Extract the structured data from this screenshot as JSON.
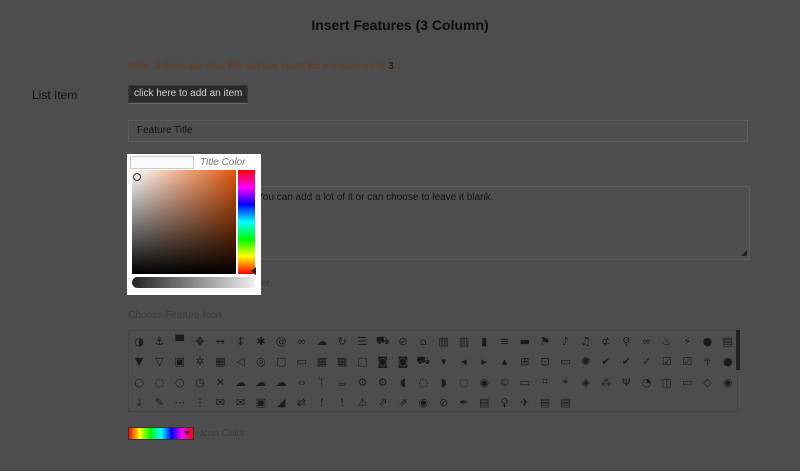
{
  "header": {
    "title": "Insert Features (3 Column)"
  },
  "note": {
    "prefix": "Note: 3 items per row. Per section insert for a maximum of ",
    "max": "3",
    "suffix": "."
  },
  "list_item": {
    "label": "List Item",
    "add_button": "click here to add an item"
  },
  "feature_title": {
    "value": "Feature Title"
  },
  "title_color": {
    "label": "Title Color"
  },
  "description": {
    "visible_text": "You can add a lot of it or can choose to leave it blank."
  },
  "color_picker": {
    "hue_color": "#e0560c"
  },
  "hidden_label_fragment": {
    "text": "er"
  },
  "icon_chooser": {
    "label": "Choose Feature Icon",
    "icons": [
      {
        "n": "adjust-icon",
        "g": "◑"
      },
      {
        "n": "anchor-icon",
        "g": "⚓"
      },
      {
        "n": "archive-icon",
        "g": "▀"
      },
      {
        "n": "move-icon",
        "g": "✥"
      },
      {
        "n": "arrows-h-icon",
        "g": "↔"
      },
      {
        "n": "arrows-v-icon",
        "g": "↕"
      },
      {
        "n": "asterisk-icon",
        "g": "✱"
      },
      {
        "n": "at-icon",
        "g": "@"
      },
      {
        "n": "link-icon",
        "g": "∞"
      },
      {
        "n": "cloud-icon",
        "g": "☁"
      },
      {
        "n": "refresh-icon",
        "g": "↻"
      },
      {
        "n": "list-icon",
        "g": "☰"
      },
      {
        "n": "car-icon",
        "g": "⛟"
      },
      {
        "n": "ban-icon",
        "g": "⊘"
      },
      {
        "n": "bank-icon",
        "g": "⌂"
      },
      {
        "n": "bar-chart-icon",
        "g": "▥"
      },
      {
        "n": "bar-chart-o-icon",
        "g": "▥"
      },
      {
        "n": "barcode-icon",
        "g": "▮"
      },
      {
        "n": "bars-icon",
        "g": "≡"
      },
      {
        "n": "bed-icon",
        "g": "▬"
      },
      {
        "n": "flag-icon",
        "g": "⚑"
      },
      {
        "n": "bell-icon",
        "g": "♪"
      },
      {
        "n": "bell-o-icon",
        "g": "♫"
      },
      {
        "n": "bell-slash-icon",
        "g": "⊄"
      },
      {
        "n": "bicycle-icon",
        "g": "⚲"
      },
      {
        "n": "binoculars-icon",
        "g": "∞"
      },
      {
        "n": "birthday-cake-icon",
        "g": "♨"
      },
      {
        "n": "bolt-icon",
        "g": "⚡"
      },
      {
        "n": "bomb-icon",
        "g": "●"
      },
      {
        "n": "book-icon",
        "g": "▤"
      },
      {
        "n": "bookmark-icon",
        "g": "▼"
      },
      {
        "n": "bookmark-o-icon",
        "g": "▽"
      },
      {
        "n": "briefcase-icon",
        "g": "▣"
      },
      {
        "n": "bug-icon",
        "g": "✲"
      },
      {
        "n": "building-icon",
        "g": "▦"
      },
      {
        "n": "bullhorn-icon",
        "g": "◁"
      },
      {
        "n": "bullseye-icon",
        "g": "◎"
      },
      {
        "n": "bus-icon",
        "g": "▢"
      },
      {
        "n": "cab-icon",
        "g": "▭"
      },
      {
        "n": "calculator-icon",
        "g": "▦"
      },
      {
        "n": "calendar-icon",
        "g": "▦"
      },
      {
        "n": "calendar-o-icon",
        "g": "□"
      },
      {
        "n": "camera-icon",
        "g": "◙"
      },
      {
        "n": "camera-retro-icon",
        "g": "◙"
      },
      {
        "n": "car2-icon",
        "g": "⛟"
      },
      {
        "n": "caret-down-icon",
        "g": "▾"
      },
      {
        "n": "caret-left-icon",
        "g": "◂"
      },
      {
        "n": "caret-right-icon",
        "g": "▸"
      },
      {
        "n": "caret-up-icon",
        "g": "▴"
      },
      {
        "n": "cart-plus-icon",
        "g": "⊞"
      },
      {
        "n": "cart-icon",
        "g": "⊡"
      },
      {
        "n": "cc-icon",
        "g": "▭"
      },
      {
        "n": "certificate-icon",
        "g": "✺"
      },
      {
        "n": "check-icon",
        "g": "✔"
      },
      {
        "n": "check-circle-icon",
        "g": "✔"
      },
      {
        "n": "check-circle-o-icon",
        "g": "✓"
      },
      {
        "n": "check-square-icon",
        "g": "☑"
      },
      {
        "n": "check-square-o-icon",
        "g": "☑"
      },
      {
        "n": "child-icon",
        "g": "☥"
      },
      {
        "n": "circle-icon",
        "g": "●"
      },
      {
        "n": "circle-o-icon",
        "g": "○"
      },
      {
        "n": "circle-notch-icon",
        "g": "◌"
      },
      {
        "n": "circle-thin-icon",
        "g": "○"
      },
      {
        "n": "clock-icon",
        "g": "◷"
      },
      {
        "n": "close-icon",
        "g": "✕"
      },
      {
        "n": "cloud2-icon",
        "g": "☁"
      },
      {
        "n": "cloud-download-icon",
        "g": "☁"
      },
      {
        "n": "cloud-upload-icon",
        "g": "☁"
      },
      {
        "n": "code-icon",
        "g": "‹›"
      },
      {
        "n": "code-fork-icon",
        "g": "ᛘ"
      },
      {
        "n": "coffee-icon",
        "g": "☕"
      },
      {
        "n": "cog-icon",
        "g": "⚙"
      },
      {
        "n": "cogs-icon",
        "g": "⚙"
      },
      {
        "n": "comment-icon",
        "g": "◖"
      },
      {
        "n": "comment-o-icon",
        "g": "◌"
      },
      {
        "n": "comments-icon",
        "g": "◗"
      },
      {
        "n": "comments-o-icon",
        "g": "◌"
      },
      {
        "n": "compass-icon",
        "g": "◉"
      },
      {
        "n": "copyright-icon",
        "g": "©"
      },
      {
        "n": "credit-card-icon",
        "g": "▭"
      },
      {
        "n": "crop-icon",
        "g": "⌗"
      },
      {
        "n": "crosshairs-icon",
        "g": "⌖"
      },
      {
        "n": "cube-icon",
        "g": "◈"
      },
      {
        "n": "cubes-icon",
        "g": "⁂"
      },
      {
        "n": "cutlery-icon",
        "g": "Ψ"
      },
      {
        "n": "dashboard-icon",
        "g": "◔"
      },
      {
        "n": "database-icon",
        "g": "◫"
      },
      {
        "n": "desktop-icon",
        "g": "▭"
      },
      {
        "n": "diamond-icon",
        "g": "◇"
      },
      {
        "n": "dot-circle-icon",
        "g": "◉"
      },
      {
        "n": "download-icon",
        "g": "⤓"
      },
      {
        "n": "edit-icon",
        "g": "✎"
      },
      {
        "n": "ellipsis-h-icon",
        "g": "⋯"
      },
      {
        "n": "ellipsis-v-icon",
        "g": "⋮"
      },
      {
        "n": "envelope-icon",
        "g": "✉"
      },
      {
        "n": "envelope-o-icon",
        "g": "✉"
      },
      {
        "n": "envelope-square-icon",
        "g": "▣"
      },
      {
        "n": "eraser-icon",
        "g": "◢"
      },
      {
        "n": "exchange-icon",
        "g": "⇄"
      },
      {
        "n": "exclamation-icon",
        "g": "!"
      },
      {
        "n": "exclamation-circle-icon",
        "g": "!"
      },
      {
        "n": "exclamation-triangle-icon",
        "g": "⚠"
      },
      {
        "n": "external-link-icon",
        "g": "⇗"
      },
      {
        "n": "external-link-square-icon",
        "g": "⇗"
      },
      {
        "n": "eye-icon",
        "g": "◉"
      },
      {
        "n": "eye-slash-icon",
        "g": "⊘"
      },
      {
        "n": "eyedropper-icon",
        "g": "✒"
      },
      {
        "n": "fax-icon",
        "g": "▤"
      },
      {
        "n": "female-icon",
        "g": "♀"
      },
      {
        "n": "fighter-jet-icon",
        "g": "✈"
      },
      {
        "n": "file-archive-icon",
        "g": "▤"
      },
      {
        "n": "file-audio-icon",
        "g": "▤"
      },
      {
        "n": "",
        "g": ""
      },
      {
        "n": "",
        "g": ""
      },
      {
        "n": "",
        "g": ""
      },
      {
        "n": "",
        "g": ""
      },
      {
        "n": "",
        "g": ""
      },
      {
        "n": "",
        "g": ""
      },
      {
        "n": "",
        "g": ""
      },
      {
        "n": "",
        "g": ""
      }
    ]
  },
  "icon_color": {
    "label": "Icon Color"
  }
}
